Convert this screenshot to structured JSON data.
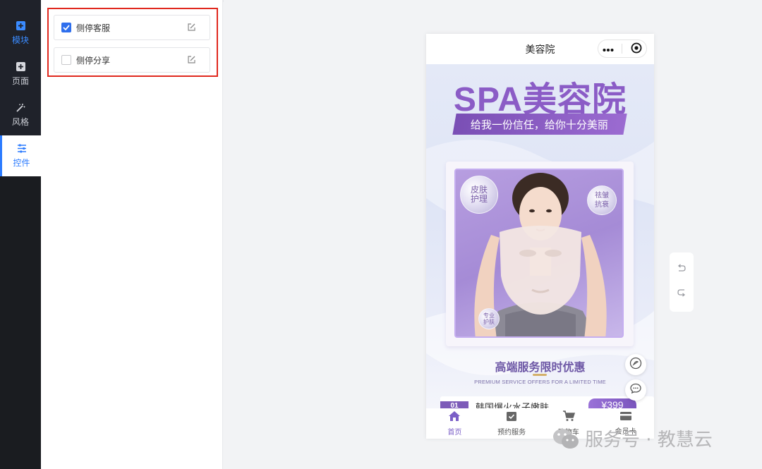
{
  "sidebar": {
    "items": [
      {
        "label": "模块",
        "icon": "plus-square-icon"
      },
      {
        "label": "页面",
        "icon": "plus-square-icon"
      },
      {
        "label": "风格",
        "icon": "magic-wand-icon"
      },
      {
        "label": "控件",
        "icon": "sliders-icon"
      }
    ]
  },
  "controls": [
    {
      "label": "侧停客服",
      "checked": true,
      "icon": "edit-icon"
    },
    {
      "label": "侧停分享",
      "checked": false,
      "icon": "edit-icon"
    }
  ],
  "phone": {
    "title": "美容院",
    "poster": {
      "title": "SPA美容院",
      "slogan": "给我一份信任，给你十分美丽",
      "bubbles": [
        "皮肤\n护理",
        "祛皱\n抗衰",
        "专业\n护肤"
      ],
      "sub_title": "高端服务限时优惠",
      "sub_title_en": "PREMIUM SERVICE OFFERS FOR A LIMITED TIME",
      "promo_number": "01",
      "promo_text": "韩国爆火水子嫩肤",
      "promo_price": "¥399"
    },
    "tabs": [
      {
        "label": "首页",
        "active": true,
        "icon": "home-icon"
      },
      {
        "label": "预约服务",
        "active": false,
        "icon": "calendar-check-icon"
      },
      {
        "label": "购物车",
        "active": false,
        "icon": "cart-icon"
      },
      {
        "label": "会员卡",
        "active": false,
        "icon": "card-icon"
      }
    ]
  },
  "watermark": "服务号 · 教慧云",
  "colors": {
    "accent_blue": "#2f6fed",
    "highlight_red": "#e0281e",
    "brand_purple": "#8b5cc6",
    "rail_dark": "#1e2127"
  }
}
